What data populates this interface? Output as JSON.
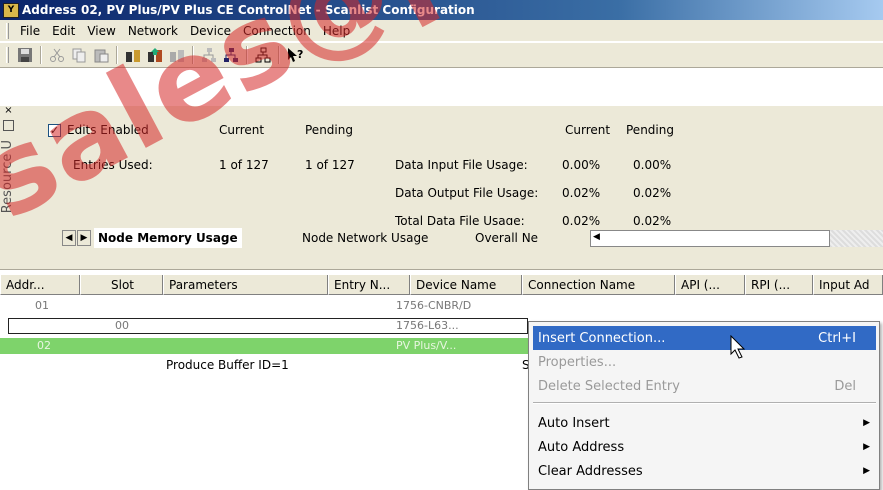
{
  "window": {
    "title": "Address 02, PV Plus/PV Plus CE ControlNet - Scanlist Configuration",
    "app_icon_text": "Y"
  },
  "menubar": {
    "items": [
      {
        "label": "File",
        "accel": "F"
      },
      {
        "label": "Edit",
        "accel": "E"
      },
      {
        "label": "View",
        "accel": "V"
      },
      {
        "label": "Network",
        "accel": "N"
      },
      {
        "label": "Device",
        "accel": "D"
      },
      {
        "label": "Connection",
        "accel": "C"
      },
      {
        "label": "Help",
        "accel": "H"
      }
    ]
  },
  "toolbar": {
    "icons": [
      "save-icon",
      "cut-icon",
      "copy-icon",
      "paste-icon",
      "online-icon",
      "upload-icon",
      "download-icon",
      "network-icon",
      "device-icon",
      "tree-icon",
      "help-pointer-icon"
    ]
  },
  "resource_panel": {
    "label": "Resource U"
  },
  "usage_panel": {
    "edits_enabled_label": "Edits Enabled",
    "edits_enabled_checked": true,
    "current_header": "Current",
    "pending_header": "Pending",
    "entries_used_label": "Entries Used:",
    "entries_current": "1 of 127",
    "entries_pending": "1 of 127",
    "right_current_header": "Current",
    "right_pending_header": "Pending",
    "input_usage_label": "Data Input File Usage:",
    "input_current": "0.00%",
    "input_pending": "0.00%",
    "output_usage_label": "Data Output File Usage:",
    "output_current": "0.02%",
    "output_pending": "0.02%",
    "total_usage_label": "Total Data File Usage:",
    "total_current": "0.02%",
    "total_pending": "0.02%"
  },
  "tabs": [
    {
      "label": "Node Memory Usage",
      "active": true
    },
    {
      "label": "Node Network Usage",
      "active": false
    },
    {
      "label": "Overall Ne",
      "active": false
    }
  ],
  "table": {
    "columns": [
      "Addr...",
      "Slot",
      "Parameters",
      "Entry N...",
      "Device Name",
      "Connection Name",
      "API (...",
      "RPI (...",
      "Input Ad"
    ],
    "rows": [
      {
        "addr": "01",
        "slot": "",
        "parameters": "",
        "device": "1756-CNBR/D",
        "extra": ""
      },
      {
        "addr": "",
        "slot": "00",
        "parameters": "",
        "device": "1756-L63...",
        "extra": ""
      },
      {
        "addr": "02",
        "slot": "",
        "parameters": "",
        "device": "PV Plus/V...",
        "extra": ""
      },
      {
        "addr": "",
        "slot": "",
        "parameters": "Produce Buffer ID=1",
        "device": "",
        "extra": "S"
      }
    ]
  },
  "context_menu": {
    "items": [
      {
        "label": "Insert Connection...",
        "accel": "I",
        "shortcut": "Ctrl+I",
        "highlighted": true,
        "disabled": false,
        "submenu": false
      },
      {
        "label": "Properties...",
        "accel": "P",
        "shortcut": "",
        "highlighted": false,
        "disabled": true,
        "submenu": false
      },
      {
        "label": "Delete Selected Entry",
        "accel": "D",
        "shortcut": "Del",
        "highlighted": false,
        "disabled": true,
        "submenu": false
      },
      {
        "label": "Auto Insert",
        "accel": "u",
        "shortcut": "",
        "highlighted": false,
        "disabled": false,
        "submenu": true
      },
      {
        "label": "Auto Address",
        "accel": "A",
        "shortcut": "",
        "highlighted": false,
        "disabled": false,
        "submenu": true
      },
      {
        "label": "Clear Addresses",
        "accel": "l",
        "shortcut": "",
        "highlighted": false,
        "disabled": false,
        "submenu": true
      }
    ]
  },
  "watermark": {
    "text": "sales@powe"
  },
  "colors": {
    "selected_row": "#7ed36b",
    "menu_highlight": "#316ac5",
    "watermark": "#d62828",
    "titlebar": "#0a246a"
  }
}
